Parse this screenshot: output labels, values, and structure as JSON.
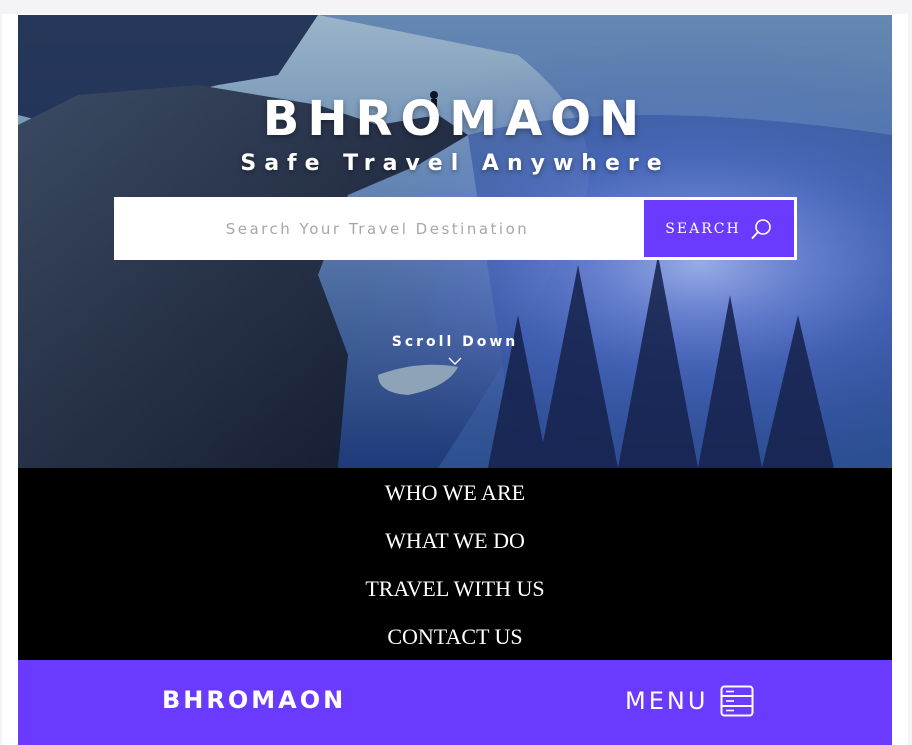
{
  "hero": {
    "title": "BHROMAON",
    "subtitle": "Safe Travel Anywhere",
    "scroll_label": "Scroll Down"
  },
  "search": {
    "placeholder": "Search Your Travel Destination",
    "button_label": "SEARCH",
    "icon": "search-icon"
  },
  "menu": {
    "items": [
      {
        "label": "WHO WE ARE"
      },
      {
        "label": "WHAT WE DO"
      },
      {
        "label": "TRAVEL WITH US"
      },
      {
        "label": "CONTACT US"
      }
    ]
  },
  "bottom_bar": {
    "logo": "BHROMAON",
    "menu_label": "MENU",
    "menu_icon": "menu-icon"
  },
  "colors": {
    "accent": "#6a3bff",
    "menu_background": "#000000",
    "text_light": "#ffffff"
  }
}
